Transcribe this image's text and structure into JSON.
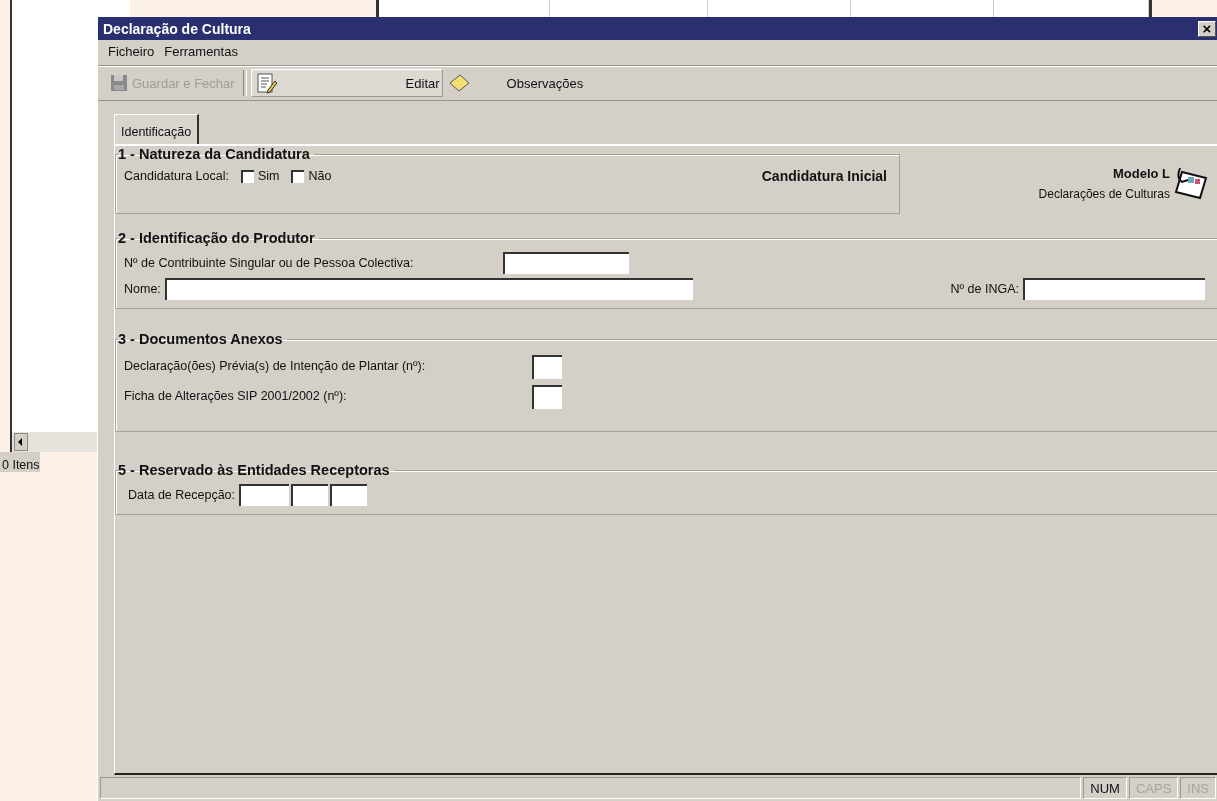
{
  "background_window": {
    "status_text": "0 Itens"
  },
  "window": {
    "title": "Declaração de Cultura",
    "close": "×"
  },
  "menu": [
    {
      "label": "Ficheiro"
    },
    {
      "label": "Ferramentas"
    }
  ],
  "toolbar": [
    {
      "label": "Guardar e Fechar",
      "kind": "save",
      "disabled": true
    },
    {
      "label": "Editar",
      "kind": "edit",
      "disabled": false
    },
    {
      "label": "Observações",
      "kind": "notes",
      "disabled": false
    }
  ],
  "tabs": [
    {
      "label": "Identificação",
      "selected": true
    }
  ],
  "section_1": {
    "title": "1 - Natureza da Candidatura",
    "label": "Candidatura Local:",
    "options": [
      {
        "label": "Sim",
        "checked": false
      },
      {
        "label": "Não",
        "checked": false
      }
    ],
    "status": "Candidatura Inicial"
  },
  "model": {
    "title": "Modelo L",
    "subtitle": "Declarações de Culturas"
  },
  "section_2": {
    "title": "2 - Identificação do Produtor",
    "contribuinte_label": "Nº de Contribuinte Singular ou de Pessoa Colectiva:",
    "nome_label": "Nome:",
    "inga_label": "Nº de INGA:"
  },
  "section_3": {
    "title": "3 - Documentos Anexos",
    "fields": [
      {
        "label": "Declaração(ões) Prévia(s) de Intenção de Plantar (nº):"
      },
      {
        "label": "Ficha de Alterações SIP 2001/2002 (nº):"
      }
    ]
  },
  "section_5": {
    "title": "5 - Reservado às Entidades Receptoras",
    "label": "Data de Recepção:"
  },
  "status_bar": [
    {
      "label": "NUM",
      "on": true
    },
    {
      "label": "CAPS",
      "on": false
    },
    {
      "label": "INS",
      "on": false
    }
  ]
}
